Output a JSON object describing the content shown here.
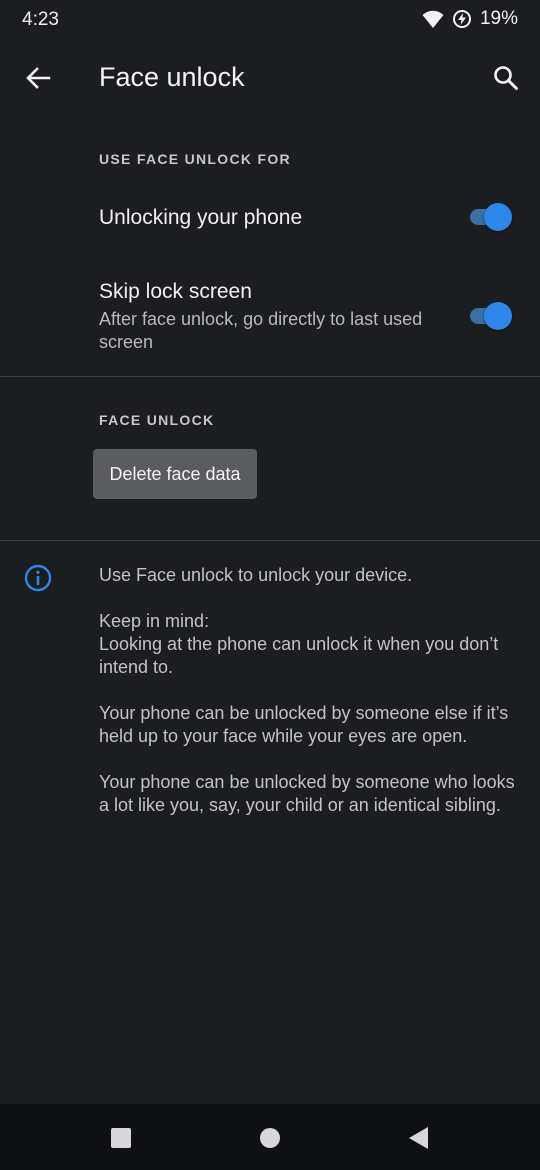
{
  "status_bar": {
    "time": "4:23",
    "battery_percent": "19%",
    "icons": [
      "wifi-icon",
      "battery-saver-icon"
    ]
  },
  "app_bar": {
    "title": "Face unlock",
    "back_icon": "arrow-back-icon",
    "search_icon": "search-icon"
  },
  "use_for_section": {
    "header": "USE FACE UNLOCK FOR",
    "items": [
      {
        "title": "Unlocking your phone",
        "summary": "",
        "enabled": true
      },
      {
        "title": "Skip lock screen",
        "summary": "After face unlock, go directly to last used screen",
        "enabled": true
      }
    ]
  },
  "face_unlock_section": {
    "header": "FACE UNLOCK",
    "delete_label": "Delete face data"
  },
  "info": {
    "icon": "info-icon",
    "paragraphs": [
      "Use Face unlock to unlock your device.",
      "Keep in mind:\nLooking at the phone can unlock it when you don’t intend to.",
      "Your phone can be unlocked by someone else if it’s held up to your face while your eyes are open.",
      "Your phone can be unlocked by someone who looks a lot like you, say, your child or an identical sibling."
    ]
  },
  "nav_bar": {
    "buttons": [
      "recents-square-icon",
      "home-circle-icon",
      "back-triangle-icon"
    ]
  },
  "colors": {
    "background": "#1c1d21",
    "accent": "#2f86e6",
    "nav_background": "#0f1012"
  }
}
